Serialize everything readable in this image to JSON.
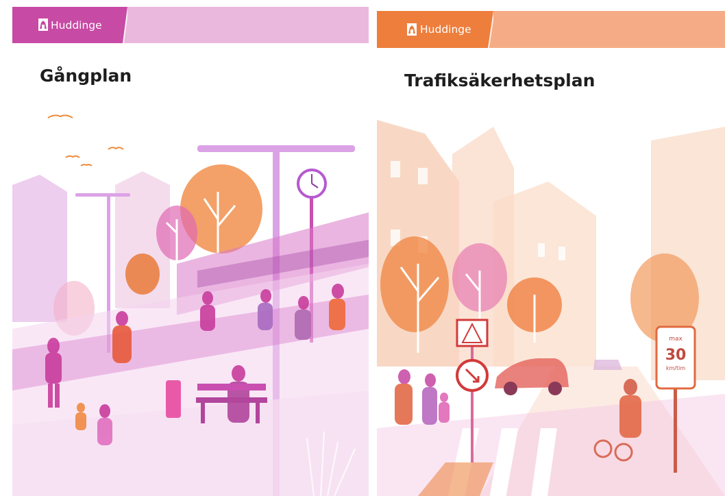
{
  "covers": [
    {
      "brand": "Huddinge",
      "title": "Gångplan",
      "logo_icon": "huddinge-coat-of-arms",
      "colors": {
        "band": "#eab8dc",
        "logo_box": "#c74aa4",
        "accent": "#c94fb0"
      }
    },
    {
      "brand": "Huddinge",
      "title": "Trafiksäkerhetsplan",
      "logo_icon": "huddinge-coat-of-arms",
      "colors": {
        "band": "#f5ac86",
        "logo_box": "#ee7e3c",
        "accent": "#ec6a34"
      },
      "speed_sign": {
        "top": "max",
        "value": "30",
        "unit": "km/tim"
      }
    }
  ]
}
